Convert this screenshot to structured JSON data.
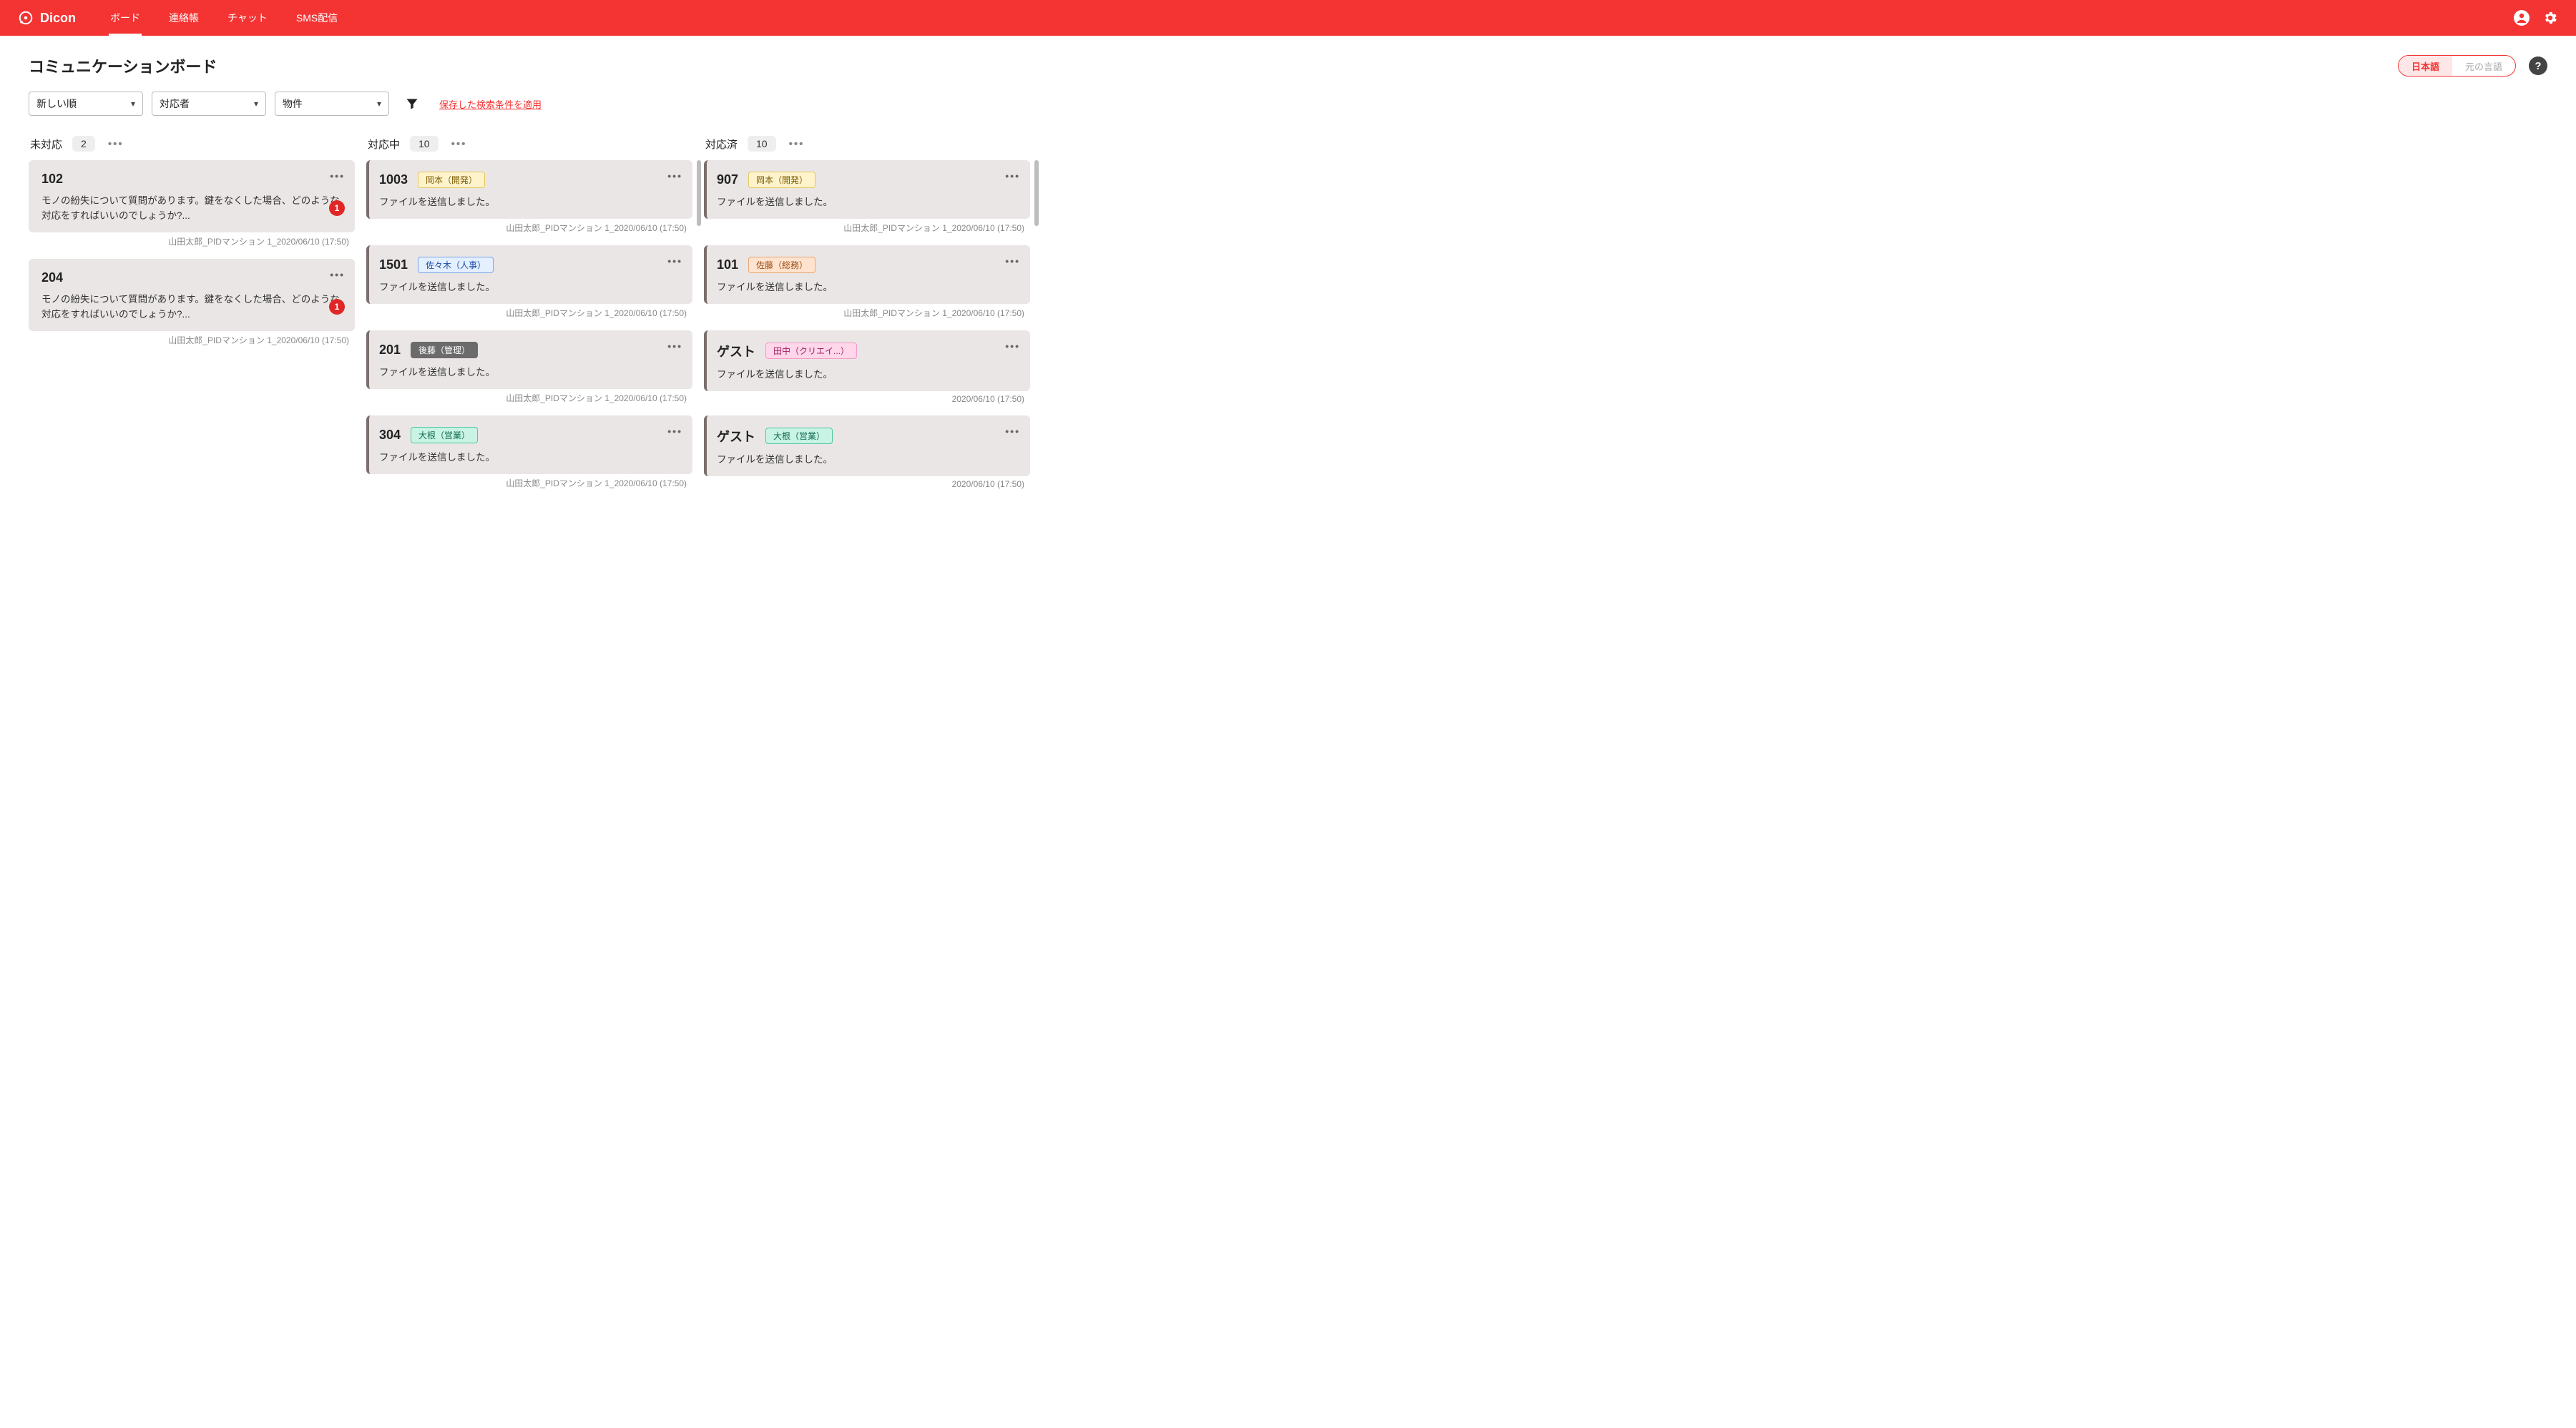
{
  "brand": {
    "name": "Dicon"
  },
  "nav": {
    "tabs": [
      {
        "label": "ボード",
        "active": true
      },
      {
        "label": "連絡帳",
        "active": false
      },
      {
        "label": "チャット",
        "active": false
      },
      {
        "label": "SMS配信",
        "active": false
      }
    ]
  },
  "page": {
    "title": "コミュニケーションボード",
    "lang_active": "日本語",
    "lang_inactive": "元の言語"
  },
  "filters": {
    "sort": "新しい順",
    "assignee": "対応者",
    "property": "物件",
    "apply_link": "保存した検索条件を適用"
  },
  "columns": [
    {
      "title": "未対応",
      "count": "2",
      "scroll": false,
      "cards": [
        {
          "room": "102",
          "tag": null,
          "msg": "モノの紛失について質問があります。鍵をなくした場合、どのような対応をすればいいのでしょうか?...",
          "badge": "1",
          "bar": false,
          "meta": "山田太郎_PIDマンション 1_2020/06/10 (17:50)"
        },
        {
          "room": "204",
          "tag": null,
          "msg": "モノの紛失について質問があります。鍵をなくした場合、どのような対応をすればいいのでしょうか?...",
          "badge": "1",
          "bar": false,
          "meta": "山田太郎_PIDマンション 1_2020/06/10 (17:50)"
        }
      ]
    },
    {
      "title": "対応中",
      "count": "10",
      "scroll": {
        "top": 0,
        "height": 92
      },
      "cards": [
        {
          "room": "1003",
          "tag": {
            "text": "岡本（開発）",
            "cls": "yellow"
          },
          "msg": "ファイルを送信しました。",
          "badge": null,
          "bar": true,
          "meta": "山田太郎_PIDマンション 1_2020/06/10 (17:50)"
        },
        {
          "room": "1501",
          "tag": {
            "text": "佐々木（人事）",
            "cls": "blue"
          },
          "msg": "ファイルを送信しました。",
          "badge": null,
          "bar": true,
          "meta": "山田太郎_PIDマンション 1_2020/06/10 (17:50)"
        },
        {
          "room": "201",
          "tag": {
            "text": "後藤（管理）",
            "cls": "gray"
          },
          "msg": "ファイルを送信しました。",
          "badge": null,
          "bar": true,
          "meta": "山田太郎_PIDマンション 1_2020/06/10 (17:50)"
        },
        {
          "room": "304",
          "tag": {
            "text": "大根（営業）",
            "cls": "teal"
          },
          "msg": "ファイルを送信しました。",
          "badge": null,
          "bar": true,
          "meta": "山田太郎_PIDマンション 1_2020/06/10 (17:50)"
        }
      ]
    },
    {
      "title": "対応済",
      "count": "10",
      "scroll": {
        "top": 0,
        "height": 92
      },
      "cards": [
        {
          "room": "907",
          "tag": {
            "text": "岡本（開発）",
            "cls": "yellow"
          },
          "msg": "ファイルを送信しました。",
          "badge": null,
          "bar": true,
          "meta": "山田太郎_PIDマンション 1_2020/06/10 (17:50)"
        },
        {
          "room": "101",
          "tag": {
            "text": "佐藤（総務）",
            "cls": "orange"
          },
          "msg": "ファイルを送信しました。",
          "badge": null,
          "bar": true,
          "meta": "山田太郎_PIDマンション 1_2020/06/10 (17:50)"
        },
        {
          "room": "ゲスト",
          "tag": {
            "text": "田中（クリエイ...）",
            "cls": "pink"
          },
          "msg": "ファイルを送信しました。",
          "badge": null,
          "bar": true,
          "meta": "2020/06/10 (17:50)"
        },
        {
          "room": "ゲスト",
          "tag": {
            "text": "大根（営業）",
            "cls": "teal"
          },
          "msg": "ファイルを送信しました。",
          "badge": null,
          "bar": true,
          "meta": "2020/06/10 (17:50)"
        }
      ]
    }
  ]
}
